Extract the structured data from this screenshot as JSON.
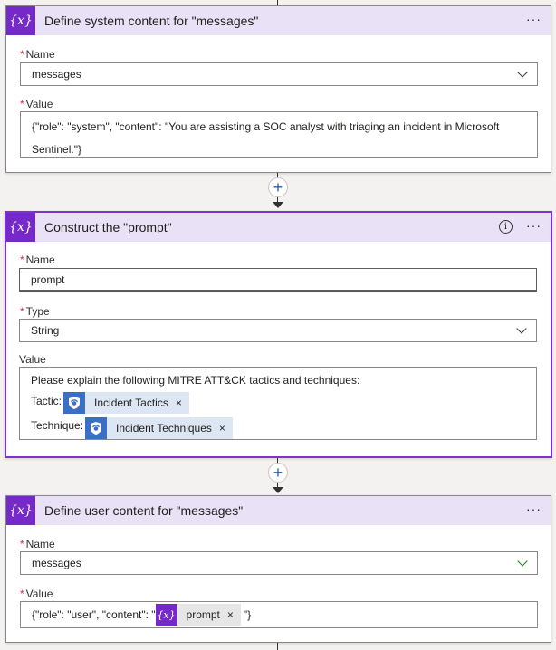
{
  "cards": [
    {
      "title": "Define system content for \"messages\"",
      "icon": "{x}",
      "more": "···",
      "name_label": "Name",
      "name_value": "messages",
      "value_label": "Value",
      "value_line1": "{\"role\": \"system\", \"content\": \"You are assisting a SOC analyst with triaging an incident in Microsoft",
      "value_line2": "Sentinel.\"}"
    },
    {
      "title": "Construct the \"prompt\"",
      "icon": "{x}",
      "more": "···",
      "info": "i",
      "name_label": "Name",
      "name_value": "prompt",
      "type_label": "Type",
      "type_value": "String",
      "value_label": "Value",
      "value_line1": "Please explain the following MITRE ATT&CK tactics and techniques:",
      "tactic_label": "Tactic:",
      "tactic_token": "Incident Tactics",
      "technique_label": "Technique:",
      "technique_token": "Incident Techniques",
      "remove": "×"
    },
    {
      "title": "Define user content for \"messages\"",
      "icon": "{x}",
      "more": "···",
      "name_label": "Name",
      "name_value": "messages",
      "value_label": "Value",
      "value_prefix": "{\"role\": \"user\", \"content\": \"",
      "value_token": "prompt",
      "value_suffix": "\"}",
      "remove": "×"
    }
  ],
  "required_mark": "*",
  "add_step": "+",
  "colors": {
    "accent": "#7529c9",
    "header_bg": "#e9e1f6",
    "token_blue": "#3a6fc4"
  }
}
